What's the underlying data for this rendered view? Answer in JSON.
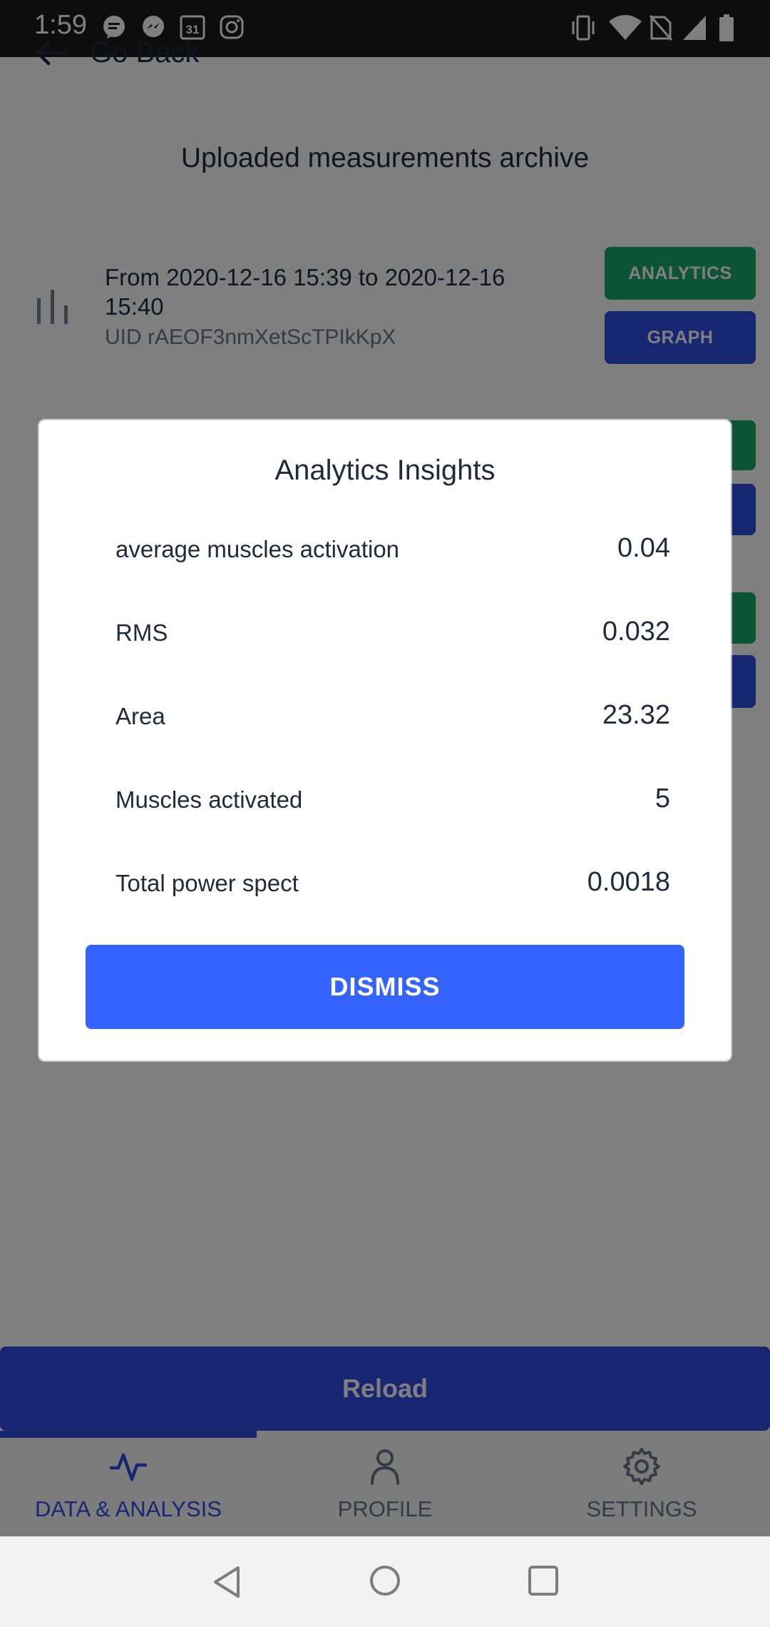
{
  "status_bar": {
    "time": "1:59",
    "notification_icons": [
      "chat-bubble-icon",
      "messenger-icon",
      "calendar-icon",
      "instagram-icon"
    ],
    "calendar_day": "31",
    "system_icons": [
      "vibrate-icon",
      "wifi-icon",
      "no-sim-icon",
      "signal-icon",
      "battery-icon"
    ]
  },
  "header": {
    "back_label": "Go Back",
    "title": "Uploaded measurements archive"
  },
  "archive": {
    "items": [
      {
        "range": "From 2020-12-16 15:39 to 2020-12-16 15:40",
        "uid": "UID rAEOF3nmXetScTPIkKpX",
        "analytics_label": "ANALYTICS",
        "graph_label": "GRAPH"
      }
    ]
  },
  "reload_label": "Reload",
  "bottom_nav": {
    "items": [
      {
        "label": "DATA & ANALYSIS",
        "icon": "pulse-icon",
        "active": true
      },
      {
        "label": "PROFILE",
        "icon": "person-icon",
        "active": false
      },
      {
        "label": "SETTINGS",
        "icon": "gear-icon",
        "active": false
      }
    ]
  },
  "dialog": {
    "title": "Analytics Insights",
    "metrics": [
      {
        "label": "average muscles activation",
        "value": "0.04"
      },
      {
        "label": "RMS",
        "value": "0.032"
      },
      {
        "label": "Area",
        "value": "23.32"
      },
      {
        "label": "Muscles activated",
        "value": "5"
      },
      {
        "label": "Total power spect",
        "value": "0.0018"
      }
    ],
    "dismiss_label": "DISMISS"
  },
  "colors": {
    "primary": "#2f4be6",
    "dismiss": "#3563ff",
    "analytics": "#17a86b",
    "graph": "#2f4de0"
  }
}
